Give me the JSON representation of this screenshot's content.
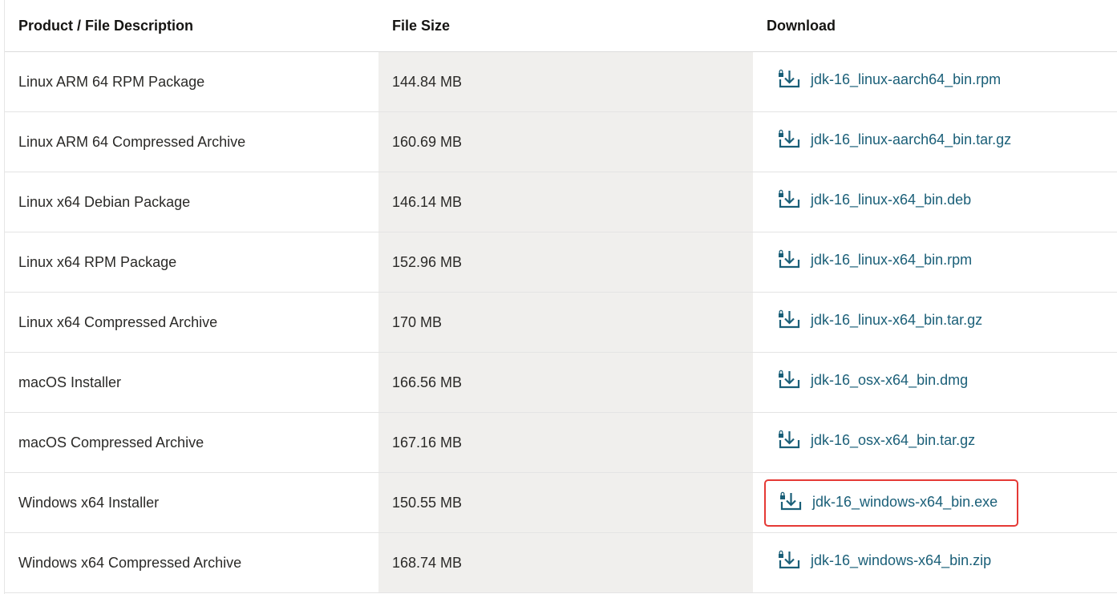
{
  "headers": {
    "description": "Product / File Description",
    "size": "File Size",
    "download": "Download"
  },
  "rows": [
    {
      "description": "Linux ARM 64 RPM Package",
      "size": "144.84 MB",
      "file": "jdk-16_linux-aarch64_bin.rpm"
    },
    {
      "description": "Linux ARM 64 Compressed Archive",
      "size": "160.69 MB",
      "file": "jdk-16_linux-aarch64_bin.tar.gz"
    },
    {
      "description": "Linux x64 Debian Package",
      "size": "146.14 MB",
      "file": "jdk-16_linux-x64_bin.deb"
    },
    {
      "description": "Linux x64 RPM Package",
      "size": "152.96 MB",
      "file": "jdk-16_linux-x64_bin.rpm"
    },
    {
      "description": "Linux x64 Compressed Archive",
      "size": "170 MB",
      "file": "jdk-16_linux-x64_bin.tar.gz"
    },
    {
      "description": "macOS Installer",
      "size": "166.56 MB",
      "file": "jdk-16_osx-x64_bin.dmg"
    },
    {
      "description": "macOS Compressed Archive",
      "size": "167.16 MB",
      "file": "jdk-16_osx-x64_bin.tar.gz"
    },
    {
      "description": "Windows x64 Installer",
      "size": "150.55 MB",
      "file": "jdk-16_windows-x64_bin.exe",
      "highlighted": true
    },
    {
      "description": "Windows x64 Compressed Archive",
      "size": "168.74 MB",
      "file": "jdk-16_windows-x64_bin.zip"
    }
  ],
  "icons": {
    "download": "download-lock-icon"
  },
  "colors": {
    "link": "#1a5f78",
    "size_column_bg": "#f0efed",
    "highlight_box": "#e53935"
  }
}
